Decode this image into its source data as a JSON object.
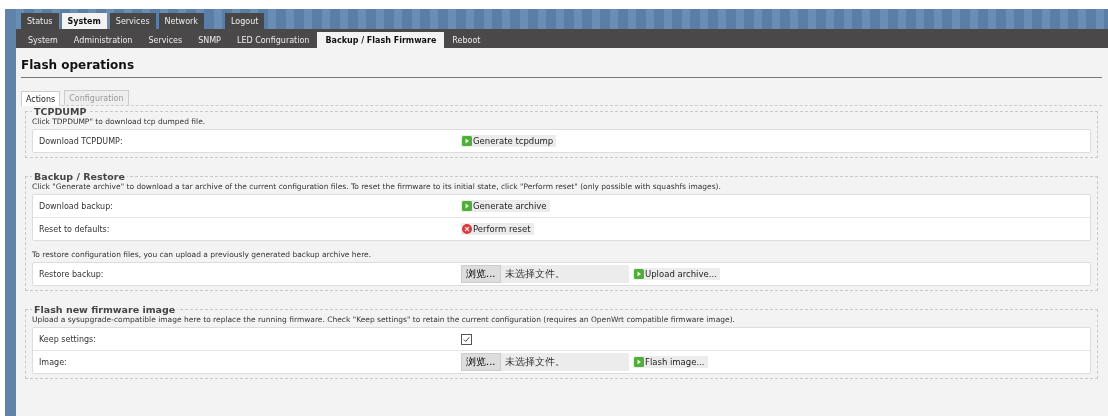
{
  "main_tabs": [
    {
      "label": "Status",
      "selected": false
    },
    {
      "label": "System",
      "selected": true
    },
    {
      "label": "Services",
      "selected": false
    },
    {
      "label": "Network",
      "selected": false
    }
  ],
  "logout": "Logout",
  "sub_tabs": [
    {
      "label": "System",
      "selected": false
    },
    {
      "label": "Administration",
      "selected": false
    },
    {
      "label": "Services",
      "selected": false
    },
    {
      "label": "SNMP",
      "selected": false
    },
    {
      "label": "LED Configuration",
      "selected": false
    },
    {
      "label": "Backup / Flash Firmware",
      "selected": true
    },
    {
      "label": "Reboot",
      "selected": false
    }
  ],
  "page_title": "Flash operations",
  "inner_tabs": [
    {
      "label": "Actions",
      "selected": true,
      "disabled": false
    },
    {
      "label": "Configuration",
      "selected": false,
      "disabled": true
    }
  ],
  "sections": [
    {
      "legend": "TCPDUMP",
      "description": "Click TDPDUMP\" to download tcp dumped file.",
      "groups": [
        {
          "rows": [
            {
              "label": "Download TCPDUMP:",
              "kind": "button",
              "button": {
                "label": "Generate tcpdump",
                "kind": "go"
              }
            }
          ]
        }
      ]
    },
    {
      "legend": "Backup / Restore",
      "description": "Click \"Generate archive\" to download a tar archive of the current configuration files. To reset the firmware to its initial state, click \"Perform reset\" (only possible with squashfs images).",
      "groups": [
        {
          "rows": [
            {
              "label": "Download backup:",
              "kind": "button",
              "button": {
                "label": "Generate archive",
                "kind": "go"
              }
            },
            {
              "label": "Reset to defaults:",
              "kind": "button",
              "button": {
                "label": "Perform reset",
                "kind": "reset"
              }
            }
          ]
        },
        {
          "note": "To restore configuration files, you can upload a previously generated backup archive here.",
          "rows": [
            {
              "label": "Restore backup:",
              "kind": "file",
              "browse": "浏览...",
              "file_status": "未选择文件。",
              "button": {
                "label": "Upload archive...",
                "kind": "go"
              }
            }
          ]
        }
      ]
    },
    {
      "legend": "Flash new firmware image",
      "description": "Upload a sysupgrade-compatible image here to replace the running firmware. Check \"Keep settings\" to retain the current configuration (requires an OpenWrt compatible firmware image).",
      "groups": [
        {
          "rows": [
            {
              "label": "Keep settings:",
              "kind": "checkbox",
              "checked": true
            },
            {
              "label": "Image:",
              "kind": "file",
              "browse": "浏览...",
              "file_status": "未选择文件。",
              "button": {
                "label": "Flash image...",
                "kind": "go"
              }
            }
          ]
        }
      ]
    }
  ]
}
